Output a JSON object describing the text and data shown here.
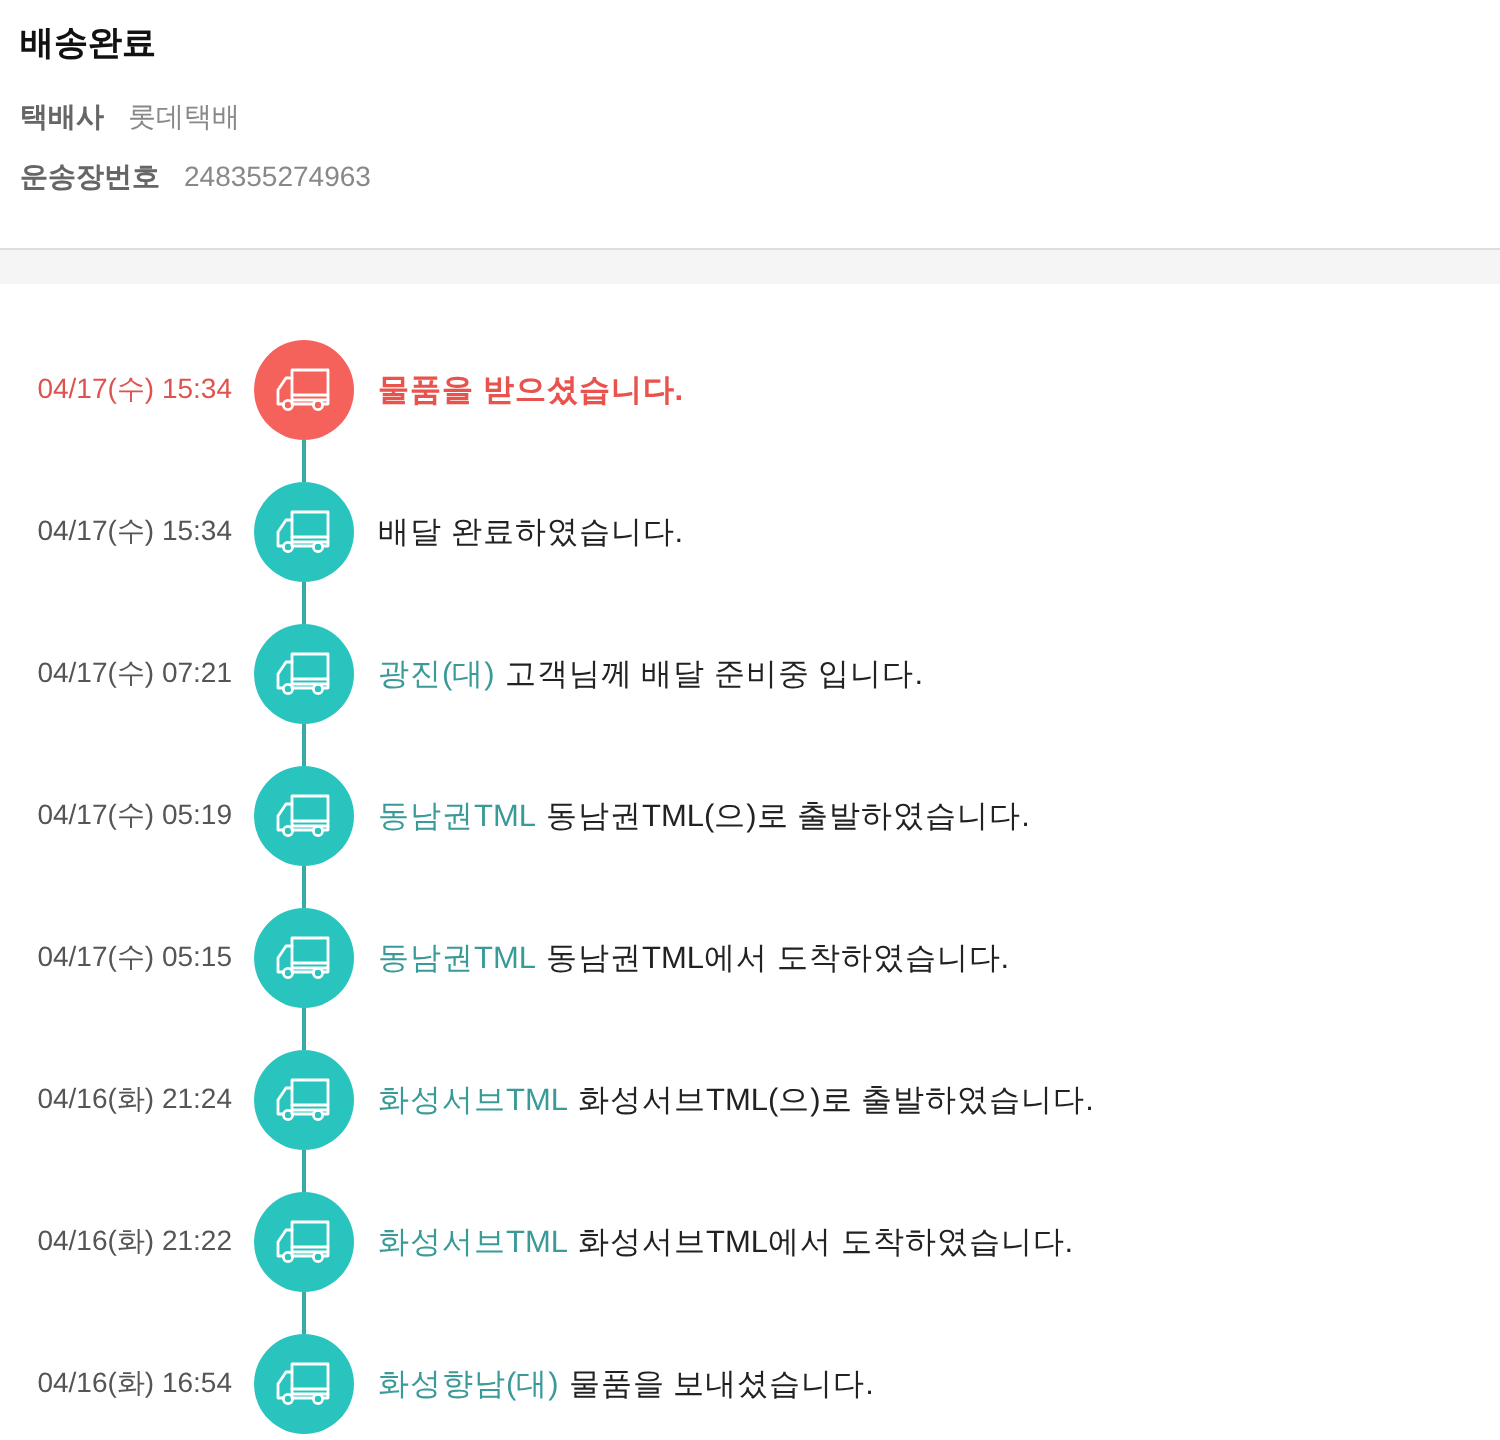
{
  "header": {
    "title": "배송완료",
    "details": [
      {
        "label": "택배사",
        "value": "롯데택배"
      },
      {
        "label": "운송장번호",
        "value": "248355274963"
      }
    ]
  },
  "events": [
    {
      "time": "04/17(수) 15:34",
      "current": true,
      "text": "물품을 받으셨습니다."
    },
    {
      "time": "04/17(수) 15:34",
      "current": false,
      "text": "배달 완료하였습니다."
    },
    {
      "time": "04/17(수) 07:21",
      "current": false,
      "location": "광진(대)",
      "text": "고객님께 배달 준비중 입니다."
    },
    {
      "time": "04/17(수) 05:19",
      "current": false,
      "location": "동남권TML",
      "text": "동남권TML(으)로 출발하였습니다."
    },
    {
      "time": "04/17(수) 05:15",
      "current": false,
      "location": "동남권TML",
      "text": "동남권TML에서 도착하였습니다."
    },
    {
      "time": "04/16(화) 21:24",
      "current": false,
      "location": "화성서브TML",
      "text": "화성서브TML(으)로 출발하였습니다."
    },
    {
      "time": "04/16(화) 21:22",
      "current": false,
      "location": "화성서브TML",
      "text": "화성서브TML에서 도착하였습니다."
    },
    {
      "time": "04/16(화) 16:54",
      "current": false,
      "location": "화성향남(대)",
      "text": "물품을 보내셨습니다."
    }
  ]
}
